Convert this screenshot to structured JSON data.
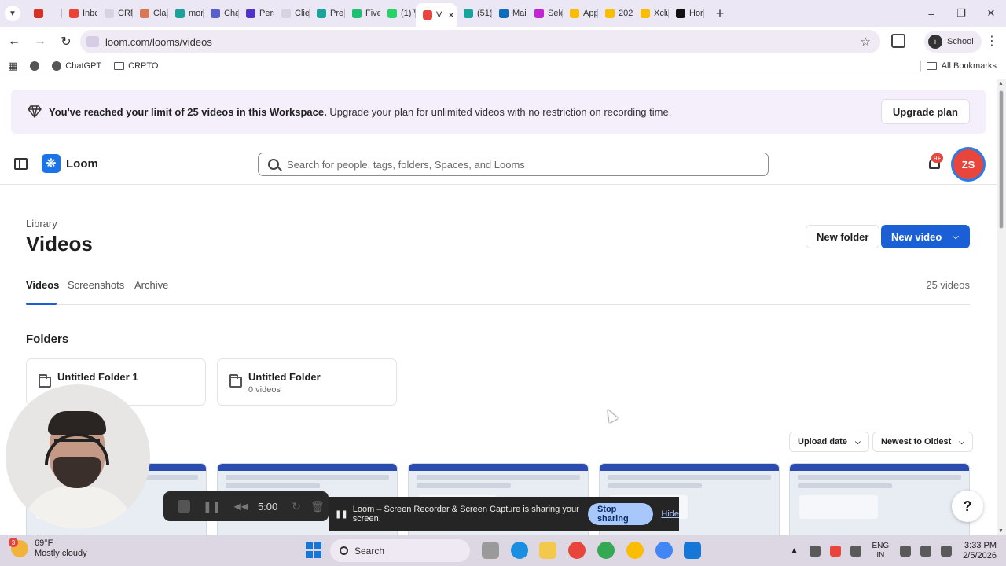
{
  "browser": {
    "tabs": [
      {
        "label": "",
        "color": "#d93025"
      },
      {
        "label": "Inbc",
        "color": "#ea4335"
      },
      {
        "label": "CRM",
        "color": "#d9d2e0"
      },
      {
        "label": "Clau",
        "color": "#d97757"
      },
      {
        "label": "mor",
        "color": "#1aa39a"
      },
      {
        "label": "Cha",
        "color": "#5b5fc7"
      },
      {
        "label": "Pers",
        "color": "#5233c7"
      },
      {
        "label": "Clie",
        "color": "#d9d2e0"
      },
      {
        "label": "Pre",
        "color": "#1aa39a"
      },
      {
        "label": "Five",
        "color": "#1dbf73"
      },
      {
        "label": "(1) \\",
        "color": "#25d366"
      },
      {
        "label": "V",
        "color": "#e8453c",
        "active": true
      },
      {
        "label": "(51)",
        "color": "#1aa39a"
      },
      {
        "label": "Mai",
        "color": "#0f6cbd"
      },
      {
        "label": "Sele",
        "color": "#c026d3"
      },
      {
        "label": "App",
        "color": "#fbbc04"
      },
      {
        "label": "202",
        "color": "#fbbc04"
      },
      {
        "label": "Xclu",
        "color": "#fbbc04"
      },
      {
        "label": "Hor",
        "color": "#111111"
      }
    ],
    "url": "loom.com/looms/videos",
    "profile_label": "School",
    "profile_initial": "i",
    "bookmarks": [
      {
        "label": "ChatGPT"
      },
      {
        "label": "CRPTO"
      }
    ],
    "all_bookmarks_label": "All Bookmarks"
  },
  "banner": {
    "bold_text": "You've reached your limit of 25 videos in this Workspace.",
    "text": " Upgrade your plan for unlimited videos with no restriction on recording time.",
    "button_label": "Upgrade plan"
  },
  "header": {
    "logo_text": "Loom",
    "search_placeholder": "Search for people, tags, folders, Spaces, and Looms",
    "notification_badge": "9+",
    "avatar_initials": "ZS"
  },
  "library": {
    "breadcrumb": "Library",
    "title": "Videos",
    "new_folder_label": "New folder",
    "new_video_label": "New video",
    "tabs": [
      {
        "label": "Videos",
        "active": true
      },
      {
        "label": "Screenshots"
      },
      {
        "label": "Archive"
      }
    ],
    "video_count": "25 videos",
    "folders_title": "Folders",
    "folders": [
      {
        "name": "Untitled Folder 1",
        "count": ""
      },
      {
        "name": "Untitled Folder",
        "count": "0 videos"
      }
    ],
    "sort_field": "Upload date",
    "sort_order": "Newest to Oldest"
  },
  "recorder": {
    "timer": "5:00",
    "share_message": "Loom – Screen Recorder & Screen Capture is sharing your screen.",
    "stop_sharing_label": "Stop sharing",
    "hide_label": "Hide"
  },
  "help_label": "?",
  "taskbar": {
    "weather_temp": "69°F",
    "weather_desc": "Mostly cloudy",
    "weather_badge": "3",
    "search_label": "Search",
    "lang_primary": "ENG",
    "lang_secondary": "IN",
    "time": "3:33 PM",
    "date": "2/5/2026"
  }
}
